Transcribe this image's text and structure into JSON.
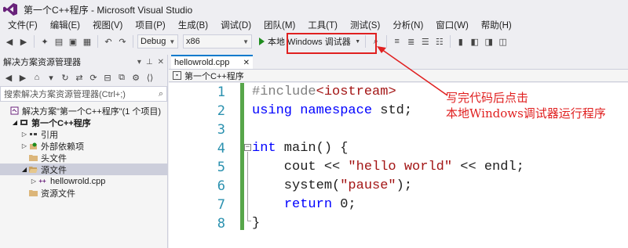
{
  "window": {
    "title": "第一个C++程序 - Microsoft Visual Studio"
  },
  "menu": [
    "文件(F)",
    "编辑(E)",
    "视图(V)",
    "项目(P)",
    "生成(B)",
    "调试(D)",
    "团队(M)",
    "工具(T)",
    "测试(S)",
    "分析(N)",
    "窗口(W)",
    "帮助(H)"
  ],
  "toolbar": {
    "config": "Debug",
    "platform": "x86",
    "run_label": "本地 Windows 调试器"
  },
  "solution_explorer": {
    "title": "解决方案资源管理器",
    "search_placeholder": "搜索解决方案资源管理器(Ctrl+;)",
    "items": [
      {
        "label": "解决方案\"第一个C++程序\"(1 个项目)",
        "indent": 0,
        "expand": "",
        "icon": "solution-icon"
      },
      {
        "label": "第一个C++程序",
        "indent": 1,
        "expand": "◢",
        "icon": "project-icon",
        "bold": true
      },
      {
        "label": "引用",
        "indent": 2,
        "expand": "▷",
        "icon": "references-icon"
      },
      {
        "label": "外部依赖项",
        "indent": 2,
        "expand": "▷",
        "icon": "external-deps-icon"
      },
      {
        "label": "头文件",
        "indent": 2,
        "expand": "",
        "icon": "folder-icon"
      },
      {
        "label": "源文件",
        "indent": 2,
        "expand": "◢",
        "icon": "folder-open-icon",
        "selected": true
      },
      {
        "label": "hellowrold.cpp",
        "indent": 3,
        "expand": "▷",
        "icon": "cpp-file-icon"
      },
      {
        "label": "资源文件",
        "indent": 2,
        "expand": "",
        "icon": "folder-icon"
      }
    ]
  },
  "editor": {
    "tab_label": "hellowrold.cpp",
    "nav_scope": "第一个C++程序",
    "line_numbers": [
      "1",
      "2",
      "3",
      "4",
      "5",
      "6",
      "7",
      "8"
    ]
  },
  "annotation": {
    "line1": "写完代码后点击",
    "line2": "本地Windows调试器运行程序"
  },
  "colors": {
    "annotation": "#e02020",
    "accent": "#007acc",
    "keyword": "#0000ff",
    "string": "#a31515",
    "change_bar": "#57a64a"
  }
}
